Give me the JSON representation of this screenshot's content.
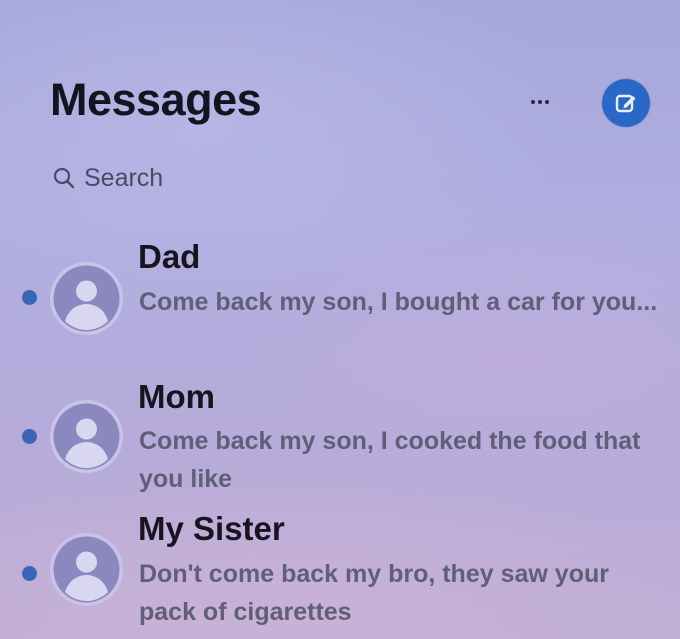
{
  "header": {
    "title": "Messages",
    "more_icon": "ellipsis-icon",
    "compose_icon": "compose-icon",
    "accent_color": "#2a68c8"
  },
  "search": {
    "icon": "search-icon",
    "placeholder": "Search"
  },
  "conversations": [
    {
      "name": "Dad",
      "preview": "Come back my son, I bought a car for you...",
      "unread": true
    },
    {
      "name": "Mom",
      "preview": "Come back my son, I cooked the food that you like",
      "unread": true
    },
    {
      "name": "My Sister",
      "preview": "Don't come back my bro, they saw your pack of cigarettes",
      "unread": true
    }
  ]
}
